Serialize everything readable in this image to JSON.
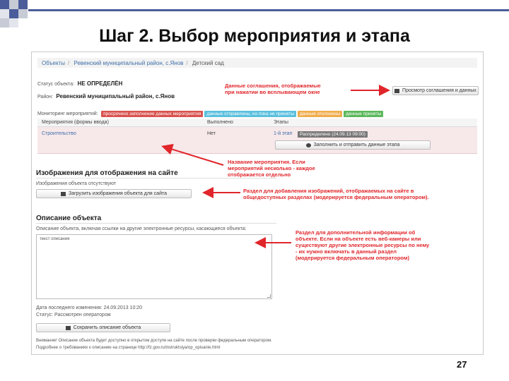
{
  "slide": {
    "title": "Шаг 2. Выбор мероприятия и этапа",
    "page_number": "27"
  },
  "breadcrumb": [
    "Объекты",
    "Ревенский муниципальный район, с.Янов",
    "Детский сад"
  ],
  "object": {
    "status_label": "Статус объекта:",
    "status_value": "НЕ ОПРЕДЕЛЁН",
    "region_label": "Район:",
    "region_value": "Ревенский муниципальный район, с.Янов",
    "agreement_button": "Просмотр соглашения и данных"
  },
  "monitoring": {
    "label": "Мониторинг мероприятий:",
    "badges": [
      {
        "text": "просрочено заполнение данных мероприятия",
        "color": "#d9534f"
      },
      {
        "text": "данные отправлены, но пока не приняты",
        "color": "#5bc0de"
      },
      {
        "text": "данные отклонены",
        "color": "#f0ad4e"
      },
      {
        "text": "данные приняты",
        "color": "#5cb85c"
      }
    ]
  },
  "table": {
    "headers": [
      "Мероприятия (формы ввода)",
      "Выполнено",
      "Этапы"
    ],
    "row": {
      "event": "Строительство",
      "done": "Нет",
      "stage": "1-й этап",
      "stage_badge": "Распределено (24.09.13 09:00)",
      "fill_button": "Заполнить и отправить данные этапа"
    }
  },
  "images_section": {
    "title": "Изображения для отображения на сайте",
    "hint": "Изображения объекта отсутствуют",
    "button": "Загрузить изображения объекта для сайта"
  },
  "description_section": {
    "title": "Описание объекта",
    "hint": "Описание объекта, включая ссылки на другие электронные ресурсы, касающиеся объекта:",
    "textarea_value": "текст описания",
    "date_line": "Дата последнего изменения: 24.09.2013 10:20",
    "status_line": "Статус: Рассмотрен оператором",
    "save_button": "Сохранить описание объекта",
    "footer_1": "Внимание! Описание объекта будет доступно в открытом доступе на сайте после проверки федеральным оператором.",
    "footer_2": "Подробнее о требованиях к описанию на странице http://fz.gov.ru/instruktsiya/op_opisanie.html"
  },
  "annotations": {
    "agreement": [
      "Данные соглашения, отображаемые",
      "при нажатии во всплывающем окне"
    ],
    "events": [
      "Название мероприятия. Если",
      "мероприятий несколько - каждое",
      "отображается отдельно"
    ],
    "images": [
      "Раздел для добавления изображений, отображаемых на сайте в",
      "общедоступных разделах (модерируется федеральным оператором)."
    ],
    "description": [
      "Раздел для дополнительной информации об",
      "объекте. Если на объекте есть веб-камеры или",
      "существуют другие электронные ресурсы по нему",
      "- их нужно включать в данный раздел",
      "(модерируется федеральным оператором)"
    ]
  },
  "colors": {
    "accent_red": "#e0262b",
    "deco_blue": "#4a5d9a",
    "link_blue": "#3e6ea8",
    "row_highlight": "#f7e8ea"
  }
}
